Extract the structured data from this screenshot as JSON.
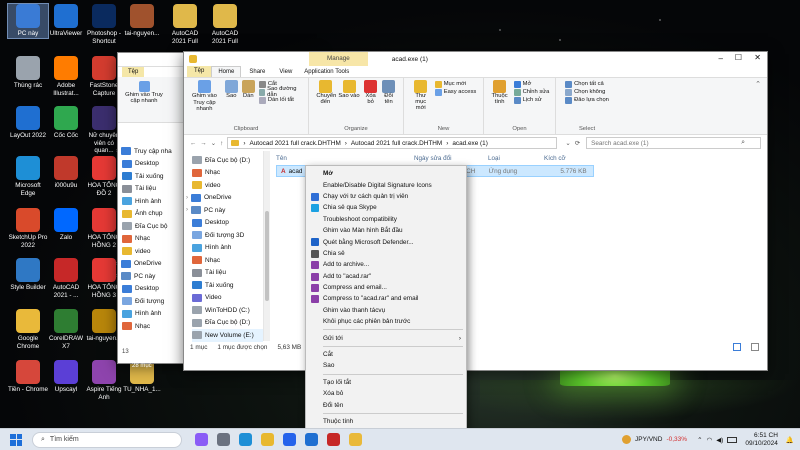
{
  "desktop": {
    "icons": [
      {
        "label": "PC này",
        "color": "#3a7bd5",
        "glyph": "computer-icon",
        "selected": true
      },
      {
        "label": "Thùng rác",
        "color": "#9aa3ad",
        "glyph": "recycle-bin-icon"
      },
      {
        "label": "LayOut 2022",
        "color": "#1f6fd1",
        "glyph": "layout-app-icon"
      },
      {
        "label": "Microsoft Edge",
        "color": "#1e8fd6",
        "glyph": "edge-icon"
      },
      {
        "label": "SketchUp Pro 2022",
        "color": "#d94a2b",
        "glyph": "sketchup-icon"
      },
      {
        "label": "Style Builder",
        "color": "#2f78c4",
        "glyph": "style-builder-icon"
      },
      {
        "label": "Google Chrome",
        "color": "#e9b93a",
        "glyph": "chrome-icon"
      },
      {
        "label": "Tiền - Chrome",
        "color": "#d6473b",
        "glyph": "chrome-profile-icon"
      },
      {
        "label": "UltraViewer",
        "color": "#1f6fd1",
        "glyph": "ultraviewer-icon"
      },
      {
        "label": "Adobe Illustrat...",
        "color": "#ff7c00",
        "glyph": "illustrator-icon"
      },
      {
        "label": "Cốc Cốc",
        "color": "#2fa84f",
        "glyph": "coccoc-icon"
      },
      {
        "label": "i000u9u",
        "color": "#c0392b",
        "glyph": "image-file-icon"
      },
      {
        "label": "Zalo",
        "color": "#0068ff",
        "glyph": "zalo-icon"
      },
      {
        "label": "AutoCAD 2021 - ...",
        "color": "#c62828",
        "glyph": "autocad-icon"
      },
      {
        "label": "CorelDRAW X7",
        "color": "#2e7d32",
        "glyph": "coreldraw-icon"
      },
      {
        "label": "Upscayl",
        "color": "#5b3fd6",
        "glyph": "upscayl-icon"
      },
      {
        "label": "Photoshop - Shortcut",
        "color": "#0a2a5e",
        "glyph": "photoshop-icon"
      },
      {
        "label": "FastStone Capture",
        "color": "#d33c2f",
        "glyph": "faststone-icon"
      },
      {
        "label": "Nữ chuyên viên có quan...",
        "color": "#3b2e6e",
        "glyph": "image-file-icon"
      },
      {
        "label": "HOA TỔNG ĐỒ 2",
        "color": "#e53935",
        "glyph": "pdf-icon"
      },
      {
        "label": "HOA TỔNG HỒNG 2",
        "color": "#e53935",
        "glyph": "pdf-icon"
      },
      {
        "label": "HOA TỔNG HỒNG 3",
        "color": "#e53935",
        "glyph": "pdf-icon"
      },
      {
        "label": "tai-nguyen...",
        "color": "#b8860b",
        "glyph": "image-file-icon"
      },
      {
        "label": "Aspire Tiếng Anh",
        "color": "#8e44ad",
        "glyph": "aspire-icon"
      },
      {
        "label": "tai-nguyen...",
        "color": "#a0522d",
        "glyph": "image-file-icon"
      },
      {
        "label": "TU_NHA_1...",
        "color": "#e0b84a",
        "glyph": "folder-icon"
      },
      {
        "label": "AutoCAD 2021 Full",
        "color": "#e0b84a",
        "glyph": "folder-icon"
      },
      {
        "label": "AutoCAD 2021 Full",
        "color": "#e0b84a",
        "glyph": "folder-icon"
      }
    ]
  },
  "back_window": {
    "tab_label": "Tệp",
    "buttons": [
      "Ghim vào Truy cập nhanh"
    ],
    "nav": [
      {
        "label": "Truy cập nha",
        "kind": "star"
      },
      {
        "label": "Desktop",
        "kind": "desktop"
      },
      {
        "label": "Tải xuống",
        "kind": "download"
      },
      {
        "label": "Tài liệu",
        "kind": "doc"
      },
      {
        "label": "Hình ảnh",
        "kind": "image"
      },
      {
        "label": "Ảnh chụp",
        "kind": "folder"
      },
      {
        "label": "Đĩa Cục bộ",
        "kind": "drive"
      },
      {
        "label": "Nhạc",
        "kind": "music"
      },
      {
        "label": "video",
        "kind": "folder"
      },
      {
        "label": "OneDrive",
        "kind": "cloud"
      },
      {
        "label": "PC này",
        "kind": "pc"
      },
      {
        "label": "Desktop",
        "kind": "desktop"
      },
      {
        "label": "Đối tượng",
        "kind": "cube"
      },
      {
        "label": "Hình ảnh",
        "kind": "image"
      },
      {
        "label": "Nhạc",
        "kind": "music"
      }
    ],
    "status": "28 mục",
    "status2": "13"
  },
  "explorer": {
    "title": "acad.exe (1)",
    "manage_tab": "Manage",
    "tabs": [
      "Tệp",
      "Home",
      "Share",
      "View",
      "Application Tools"
    ],
    "ribbon": {
      "clipboard_group": "Clipboard",
      "organize_group": "Organize",
      "new_group": "New",
      "open_group": "Open",
      "select_group": "Select",
      "pin": "Ghim vào Truy cập nhanh",
      "copy": "Sao",
      "paste": "Dán",
      "cut": "Cắt",
      "copy_path": "Sao đường dẫn",
      "paste_shortcut": "Dán lối tắt",
      "move_to": "Chuyển đến",
      "copy_to": "Sao vào",
      "delete": "Xóa bỏ",
      "rename": "Đổi tên",
      "new_folder": "Thư mục mới",
      "new_item": "Mục mới",
      "easy_access": "Easy access",
      "properties": "Thuộc tính",
      "open": "Mở",
      "edit": "Chỉnh sửa",
      "history": "Lịch sử",
      "select_all": "Chọn tất cả",
      "select_none": "Chọn không",
      "invert": "Đảo lựa chọn"
    },
    "breadcrumb": [
      "Autocad 2021 full crack.DHTHM",
      "Autocad 2021 full crack.DHTHM",
      "acad.exe (1)"
    ],
    "search_placeholder": "Search acad.exe (1)",
    "nav": [
      {
        "label": "Đĩa Cục bộ (D:)",
        "kind": "drive"
      },
      {
        "label": "Nhạc",
        "kind": "music"
      },
      {
        "label": "video",
        "kind": "folder"
      },
      {
        "label": "OneDrive",
        "kind": "cloud"
      },
      {
        "label": "PC này",
        "kind": "pc"
      },
      {
        "label": "Desktop",
        "kind": "desktop"
      },
      {
        "label": "Đối tượng 3D",
        "kind": "cube"
      },
      {
        "label": "Hình ảnh",
        "kind": "image"
      },
      {
        "label": "Nhạc",
        "kind": "music"
      },
      {
        "label": "Tài liệu",
        "kind": "doc"
      },
      {
        "label": "Tải xuống",
        "kind": "download"
      },
      {
        "label": "Video",
        "kind": "video"
      },
      {
        "label": "WinToHDD (C:)",
        "kind": "drive"
      },
      {
        "label": "Đĩa Cục bộ (D:)",
        "kind": "drive"
      },
      {
        "label": "New Volume (E:)",
        "kind": "drive"
      }
    ],
    "columns": [
      "Tên",
      "Ngày sửa đổi",
      "Loại",
      "Kích cỡ"
    ],
    "file": {
      "name": "acad",
      "date": "07/10/2024 12:25 CH",
      "type": "Ứng dụng",
      "size": "5.776 KB"
    },
    "status_count": "1 mục",
    "status_selected": "1 mục được chọn",
    "status_size": "5,63 MB"
  },
  "context_menu": [
    {
      "label": "Mở",
      "bold": true
    },
    {
      "label": "Enable/Disable Digital Signature Icons"
    },
    {
      "label": "Chạy với tư cách quản trị viên",
      "glyph": "shield-icon",
      "color": "#2f6fd6"
    },
    {
      "label": "Chia sẻ qua Skype",
      "glyph": "skype-icon",
      "color": "#1ba1e2"
    },
    {
      "label": "Troubleshoot compatibility"
    },
    {
      "label": "Ghim vào Màn hình Bắt đầu"
    },
    {
      "label": "Quét bằng Microsoft Defender...",
      "glyph": "defender-icon",
      "color": "#1e63c8"
    },
    {
      "label": "Chia sẻ",
      "glyph": "share-icon",
      "color": "#555"
    },
    {
      "label": "Add to archive...",
      "glyph": "winrar-icon",
      "color": "#8b3fa8"
    },
    {
      "label": "Add to \"acad.rar\"",
      "glyph": "winrar-icon",
      "color": "#8b3fa8"
    },
    {
      "label": "Compress and email...",
      "glyph": "winrar-icon",
      "color": "#8b3fa8"
    },
    {
      "label": "Compress to \"acad.rar\" and email",
      "glyph": "winrar-icon",
      "color": "#8b3fa8"
    },
    {
      "label": "Ghim vào thanh tácvụ"
    },
    {
      "label": "Khôi phục các phiên bản trước"
    },
    {
      "sep": true
    },
    {
      "label": "Gửi tới",
      "submenu": true
    },
    {
      "sep": true
    },
    {
      "label": "Cắt"
    },
    {
      "label": "Sao"
    },
    {
      "sep": true
    },
    {
      "label": "Tạo lối tắt"
    },
    {
      "label": "Xóa bỏ"
    },
    {
      "label": "Đổi tên"
    },
    {
      "sep": true
    },
    {
      "label": "Thuộc tính"
    }
  ],
  "taskbar": {
    "search": "Tìm kiếm",
    "apps": [
      {
        "name": "copilot-icon",
        "color": "#8a5cf6"
      },
      {
        "name": "task-view-icon",
        "color": "#6b7280"
      },
      {
        "name": "edge-icon",
        "color": "#1e8fd6"
      },
      {
        "name": "file-explorer-icon",
        "color": "#e8b830"
      },
      {
        "name": "store-icon",
        "color": "#2563eb"
      },
      {
        "name": "mail-icon",
        "color": "#1f6fd1"
      },
      {
        "name": "autocad-icon",
        "color": "#c62828"
      },
      {
        "name": "chrome-icon",
        "color": "#e9b93a"
      }
    ],
    "currency": "JPY/VND",
    "change": "-0,33%",
    "time": "6:51 CH",
    "date": "09/10/2024"
  },
  "colors": {
    "accent": "#1e6fd9",
    "selection": "#cce8ff",
    "manage_tab": "#f7e6a8",
    "change": "#d32f2f"
  }
}
